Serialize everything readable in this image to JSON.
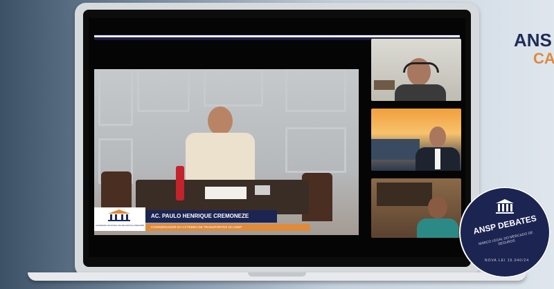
{
  "background": {
    "colors": [
      "#3d5166",
      "#dfe6ed"
    ]
  },
  "brand": {
    "line1": "ANS",
    "line2": "CA",
    "color_primary": "#1f2b57",
    "color_accent": "#e08a3a"
  },
  "main_speaker": {
    "name": "AC. PAULO HENRIQUE CREMONEZE",
    "role": "COORDENADOR DA CÂTEDRA DE TRANSPORTES DA ANSP",
    "logo_text": "ACADEMIA NACIONAL DE SEGUROS E PREVIDÊNCIA",
    "logo_icon": "building-columns-icon"
  },
  "participants": [
    {
      "label": "participant-1"
    },
    {
      "label": "participant-2"
    },
    {
      "label": "participant-3"
    }
  ],
  "badge": {
    "title": "ANSP DEBATES",
    "subtitle": "MARCO LEGAL DO MERCADO DE SEGUROS",
    "law": "NOVA LEI 15.040/24",
    "icon": "building-columns-icon"
  }
}
